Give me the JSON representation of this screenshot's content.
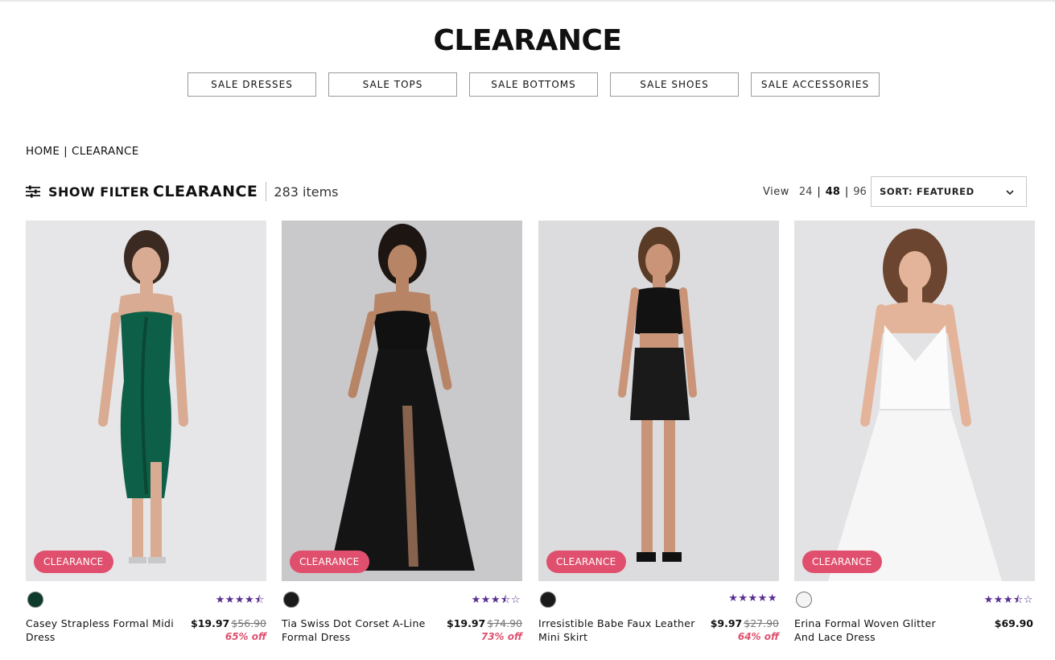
{
  "page": {
    "title": "CLEARANCE"
  },
  "categories": [
    {
      "label": "SALE DRESSES"
    },
    {
      "label": "SALE TOPS"
    },
    {
      "label": "SALE BOTTOMS"
    },
    {
      "label": "SALE SHOES"
    },
    {
      "label": "SALE ACCESSORIES"
    }
  ],
  "breadcrumb": {
    "home": "HOME",
    "separator": "|",
    "current": "CLEARANCE"
  },
  "toolbar": {
    "filter_label": "SHOW FILTER",
    "listing_title": "CLEARANCE",
    "item_count": "283 items",
    "view_label": "View",
    "view_options": [
      "24",
      "48",
      "96"
    ],
    "view_active": "48",
    "sort_label": "SORT: FEATURED"
  },
  "products": [
    {
      "name": "Casey Strapless Formal Midi Dress",
      "badge": "CLEARANCE",
      "price": "$19.97",
      "was": "$56.90",
      "off": "65% off",
      "swatch": "#0d3b2c",
      "stars": "★★★★⯪",
      "icon": "green-dress-image"
    },
    {
      "name": "Tia Swiss Dot Corset A-Line Formal Dress",
      "badge": "CLEARANCE",
      "price": "$19.97",
      "was": "$74.90",
      "off": "73% off",
      "swatch": "#1a1a1a",
      "stars": "★★★⯪☆",
      "icon": "black-gown-image"
    },
    {
      "name": "Irresistible Babe Faux Leather Mini Skirt",
      "badge": "CLEARANCE",
      "price": "$9.97",
      "was": "$27.90",
      "off": "64% off",
      "swatch": "#1a1a1a",
      "stars": "★★★★★",
      "icon": "leather-skirt-image"
    },
    {
      "name": "Erina Formal Woven Glitter And Lace Dress",
      "badge": "CLEARANCE",
      "price": "$69.90",
      "was": "",
      "off": "",
      "swatch": "#f4f4f4",
      "stars": "★★★⯪☆",
      "icon": "white-dress-image"
    }
  ]
}
